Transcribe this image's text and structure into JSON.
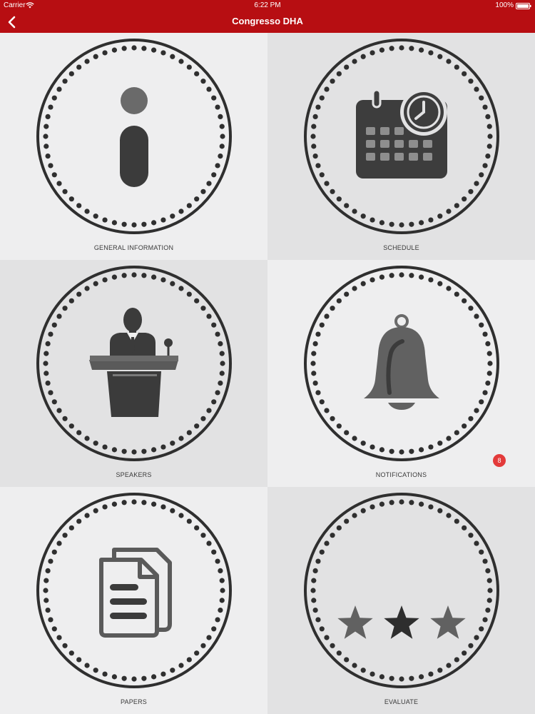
{
  "status_bar": {
    "carrier": "Carrier",
    "time": "6:22 PM",
    "battery": "100%"
  },
  "nav": {
    "title": "Congresso DHA",
    "back_icon": "chevron-left-icon"
  },
  "colors": {
    "header": "#b70e12",
    "tile_light": "#eeeeef",
    "tile_dark": "#e2e2e3",
    "badge": "#e33a3a",
    "icon": "#404040"
  },
  "tiles": [
    {
      "label": "GENERAL INFORMATION",
      "icon": "info-icon"
    },
    {
      "label": "SCHEDULE",
      "icon": "calendar-clock-icon"
    },
    {
      "label": "SPEAKERS",
      "icon": "speaker-podium-icon"
    },
    {
      "label": "NOTIFICATIONS",
      "icon": "bell-icon"
    },
    {
      "label": "PAPERS",
      "icon": "documents-icon"
    },
    {
      "label": "EVALUATE",
      "icon": "stars-icon"
    }
  ],
  "notifications_badge": "8"
}
